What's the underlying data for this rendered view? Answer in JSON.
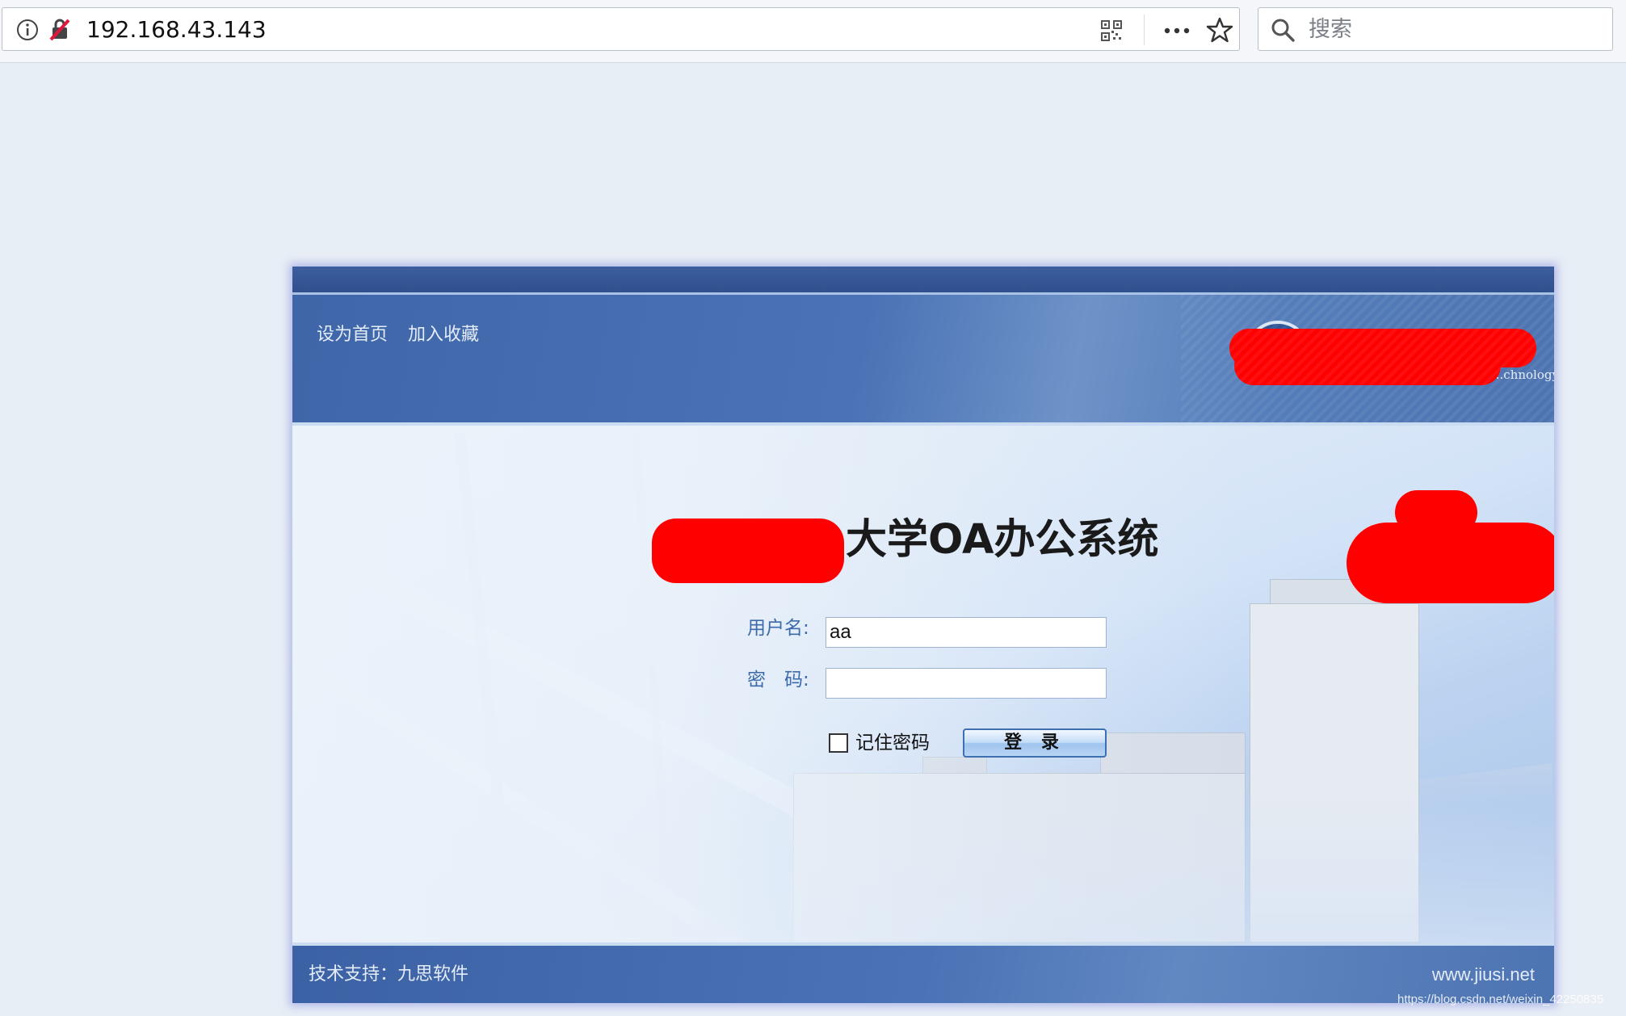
{
  "browser": {
    "url": "192.168.43.143",
    "search_placeholder": "搜索"
  },
  "header": {
    "links": [
      "设为首页",
      "加入收藏"
    ],
    "logo_partial_text": "...chnology"
  },
  "main": {
    "system_title": "大学OA办公系统",
    "username_label": "用户名:",
    "username_value": "aa",
    "password_label": "密　码:",
    "password_value": "",
    "remember_label": "记住密码",
    "remember_checked": false,
    "login_button": "登 录"
  },
  "footer": {
    "support": "技术支持：九思软件",
    "site": "www.jiusi.net"
  },
  "watermark": "https://blog.csdn.net/weixin_42250835",
  "colors": {
    "banner": "#4a72b5",
    "redaction": "#ff0000",
    "label_blue": "#3d6aa8"
  }
}
